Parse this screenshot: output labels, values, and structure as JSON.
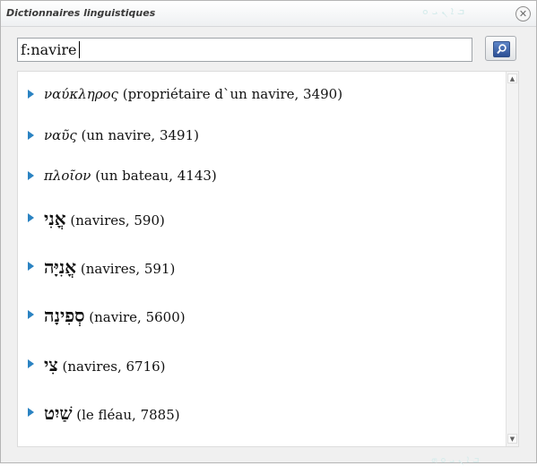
{
  "window": {
    "title": "Dictionnaires linguistiques"
  },
  "search": {
    "value": "f:navire"
  },
  "icons": {
    "close": "close-icon",
    "search": "magnifier-icon",
    "bullet": "triangle-right-icon",
    "scroll_up": "triangle-up-icon",
    "scroll_down": "triangle-down-icon"
  },
  "entries": [
    {
      "word": "ναύκληρος",
      "desc": " (propriétaire d`un navire, 3490)"
    },
    {
      "word": "ναῦς",
      "desc": " (un navire, 3491)"
    },
    {
      "word": "πλοῖον",
      "desc": " (un bateau, 4143)"
    },
    {
      "word": "אֳנִי",
      "desc": " (navires, 590)"
    },
    {
      "word": "אֳנִיָּה",
      "desc": " (navires, 591)"
    },
    {
      "word": "סְפִינָה",
      "desc": " (navire, 5600)"
    },
    {
      "word": "צִי",
      "desc": " (navires, 6716)"
    },
    {
      "word": "שַׁיִט",
      "desc": " (le fléau, 7885)"
    }
  ],
  "colors": {
    "bullet": "#2b83c2",
    "search_button": "#2c4f94"
  }
}
